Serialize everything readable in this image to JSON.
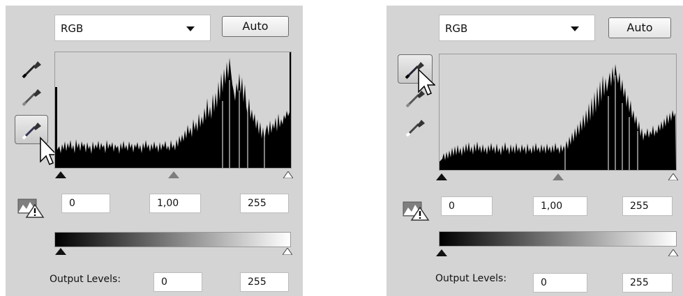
{
  "left_panel": {
    "channel": "RGB",
    "auto_label": "Auto",
    "input_black": "0",
    "input_gamma": "1,00",
    "input_white": "255",
    "output_label": "Output Levels:",
    "output_black": "0",
    "output_white": "255",
    "active_eyedropper": "white-point"
  },
  "right_panel": {
    "channel": "RGB",
    "auto_label": "Auto",
    "input_black": "0",
    "input_gamma": "1,00",
    "input_white": "255",
    "output_label": "Output Levels:",
    "output_black": "0",
    "output_white": "255",
    "active_eyedropper": "black-point"
  },
  "colors": {
    "panel_bg": "#d4d4d4",
    "histogram_fill": "#000000"
  }
}
